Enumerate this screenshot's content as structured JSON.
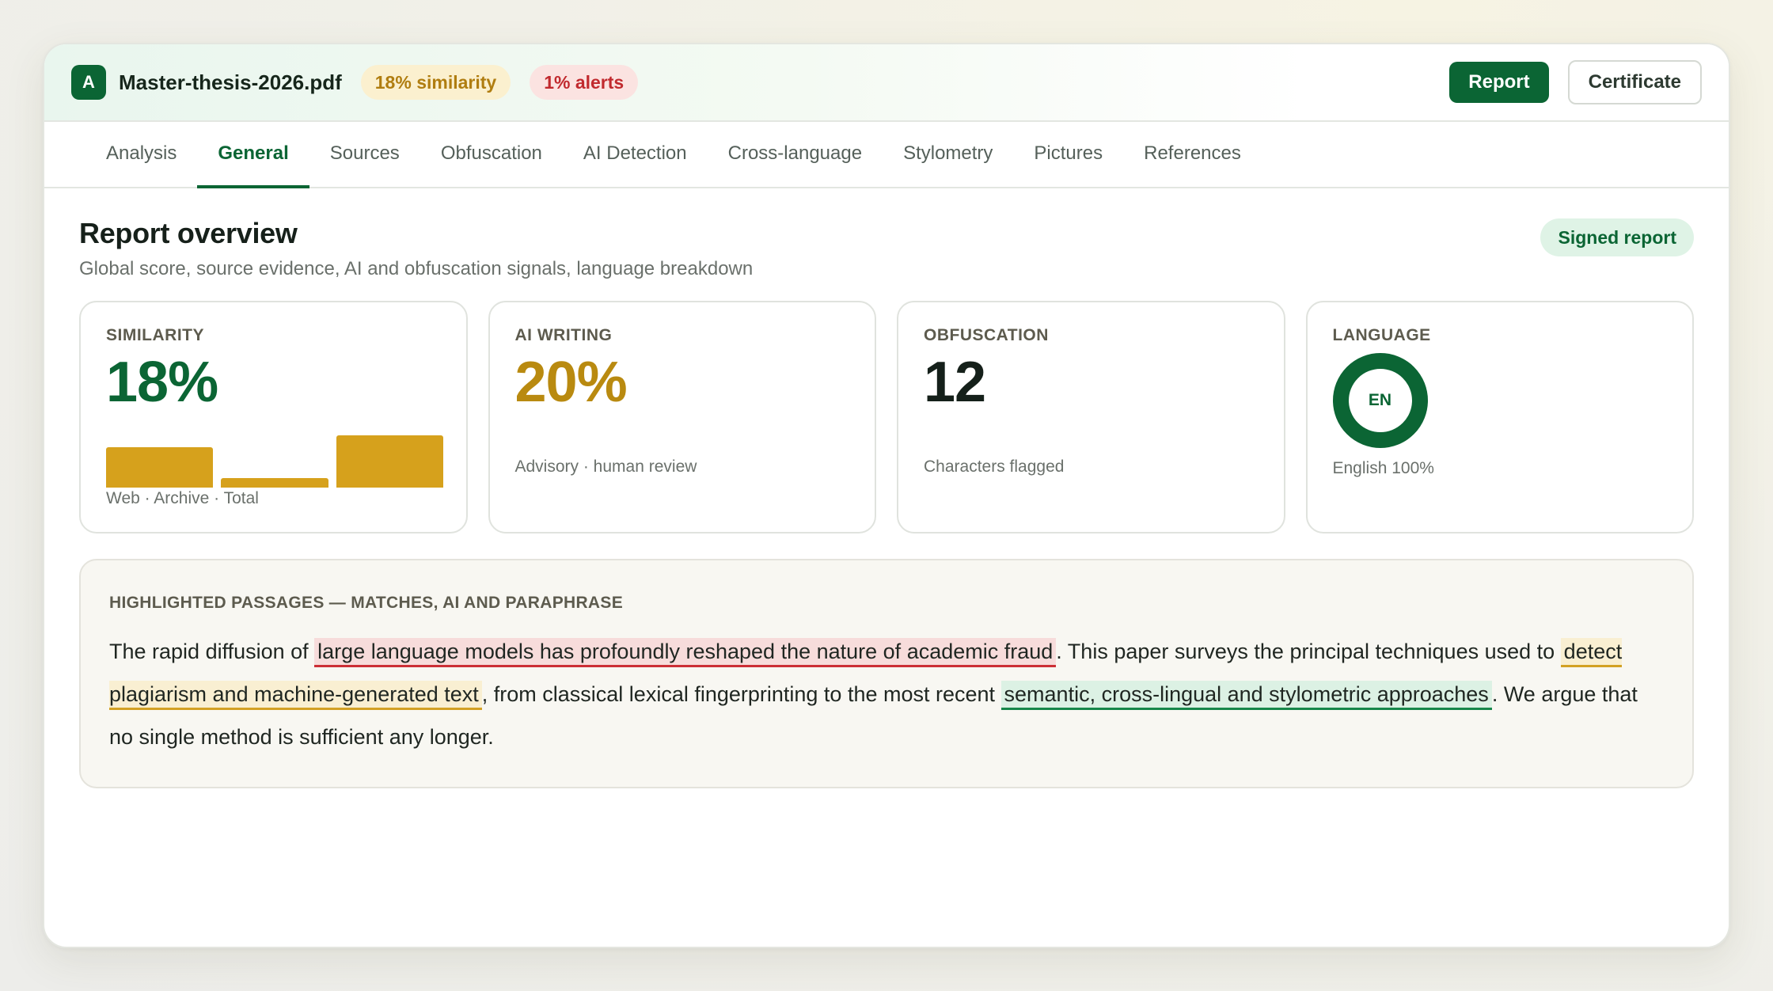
{
  "header": {
    "logo_letter": "A",
    "filename": "Master-thesis-2026.pdf",
    "similarity_badge": "18% similarity",
    "alerts_badge": "1% alerts",
    "report_button": "Report",
    "certificate_button": "Certificate"
  },
  "tabs": [
    {
      "label": "Analysis",
      "active": false
    },
    {
      "label": "General",
      "active": true
    },
    {
      "label": "Sources",
      "active": false
    },
    {
      "label": "Obfuscation",
      "active": false
    },
    {
      "label": "AI Detection",
      "active": false
    },
    {
      "label": "Cross-language",
      "active": false
    },
    {
      "label": "Stylometry",
      "active": false
    },
    {
      "label": "Pictures",
      "active": false
    },
    {
      "label": "References",
      "active": false
    }
  ],
  "overview": {
    "title": "Report overview",
    "subtitle": "Global score, source evidence, AI and obfuscation signals, language breakdown",
    "signed_badge": "Signed report"
  },
  "cards": {
    "similarity": {
      "label": "SIMILARITY",
      "value": "18%",
      "bars_caption": "Web · Archive · Total",
      "bars": [
        {
          "name": "Web",
          "level": 0.78
        },
        {
          "name": "Archive",
          "level": 0.18
        },
        {
          "name": "Total",
          "level": 1.0
        }
      ]
    },
    "ai_writing": {
      "label": "AI WRITING",
      "value": "20%",
      "note": "Advisory · human review"
    },
    "obfuscation": {
      "label": "OBFUSCATION",
      "value": "12",
      "note": "Characters flagged"
    },
    "language": {
      "label": "LANGUAGE",
      "code": "EN",
      "note": "English 100%",
      "share": 1.0
    }
  },
  "passages": {
    "label": "HIGHLIGHTED PASSAGES — MATCHES, AI AND PARAPHRASE",
    "segments": [
      {
        "text": "The rapid diffusion of ",
        "type": "plain"
      },
      {
        "text": "large language models has profoundly reshaped the nature of academic fraud",
        "type": "match"
      },
      {
        "text": ". This paper surveys the principal techniques used to ",
        "type": "plain"
      },
      {
        "text": "detect plagiarism and machine-generated text",
        "type": "ai"
      },
      {
        "text": ", from classical lexical fingerprinting to the most recent ",
        "type": "plain"
      },
      {
        "text": "semantic, cross-lingual and stylometric approaches",
        "type": "paraphrase"
      },
      {
        "text": ". We argue that no single method is sufficient any longer.",
        "type": "plain"
      }
    ]
  },
  "colors": {
    "brand": "#0b6534",
    "gold": "#d6a11c",
    "alert": "#c12a2e"
  }
}
